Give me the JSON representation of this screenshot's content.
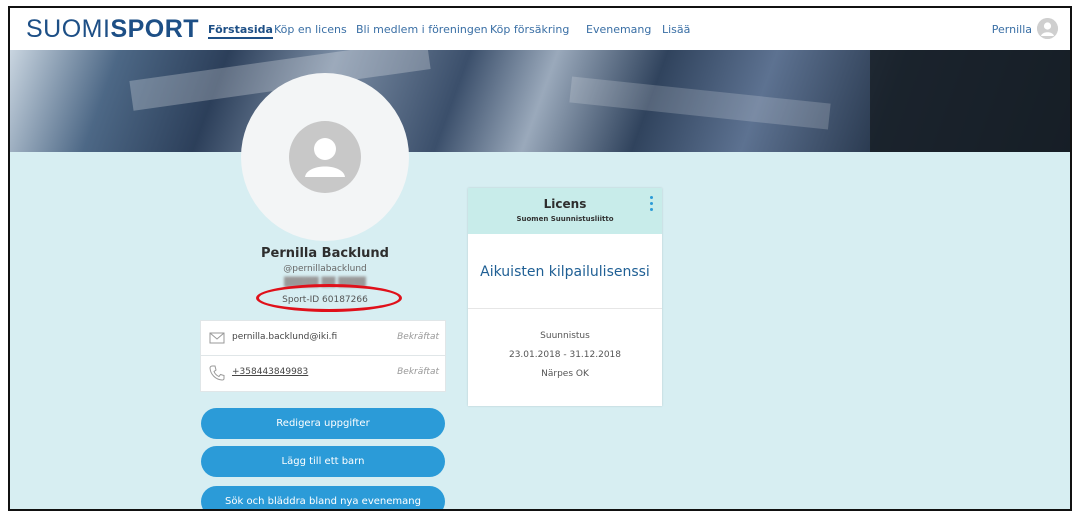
{
  "nav": {
    "logo_light": "SUOMI",
    "logo_bold": "SPORT",
    "items": [
      {
        "label": "Förstasida"
      },
      {
        "label": "Köp en licens"
      },
      {
        "label": "Bli medlem i föreningen"
      },
      {
        "label": "Köp försäkring"
      },
      {
        "label": "Evenemang"
      },
      {
        "label": "Lisää"
      }
    ],
    "user_name": "Pernilla"
  },
  "profile": {
    "name": "Pernilla Backlund",
    "handle": "@pernillabacklund",
    "sport_id": "Sport-ID 60187266"
  },
  "contacts": {
    "email": "pernilla.backlund@iki.fi",
    "email_status": "Bekräftat",
    "phone": "+358443849983",
    "phone_status": "Bekräftat"
  },
  "buttons": {
    "edit": "Redigera uppgifter",
    "add_child": "Lägg till ett barn",
    "browse_events": "Sök och bläddra bland nya evenemang"
  },
  "license": {
    "title": "Licens",
    "organization": "Suomen Suunnistusliitto",
    "name": "Aikuisten kilpailulisenssi",
    "sport": "Suunnistus",
    "validity": "23.01.2018 - 31.12.2018",
    "club": "Närpes OK"
  },
  "colors": {
    "brand": "#1d4f86",
    "button": "#2b9bd8",
    "page_bg": "#d7eef2",
    "highlight": "#e0101a"
  }
}
